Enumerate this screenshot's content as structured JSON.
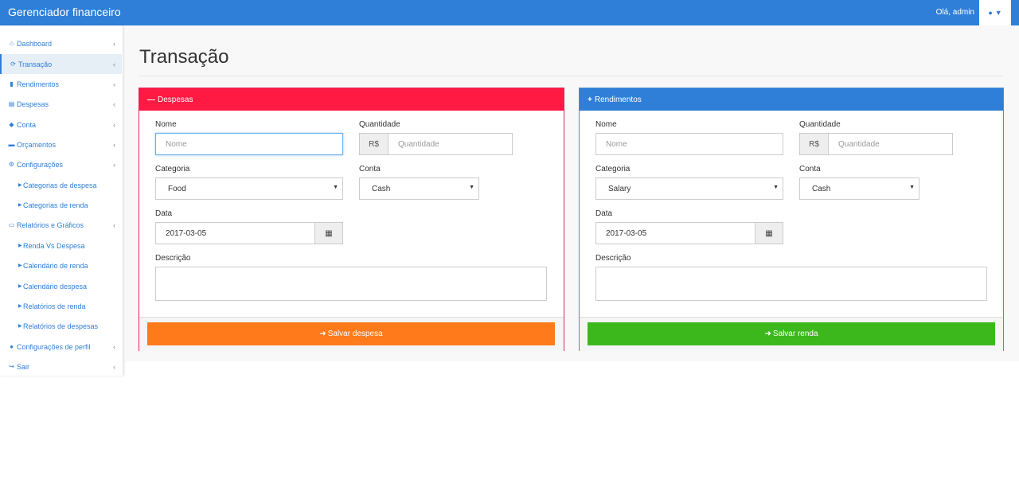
{
  "app": {
    "title": "Gerenciador financeiro",
    "greeting": "Olá, admin",
    "user_icon": "user-icon"
  },
  "sidebar": {
    "items": [
      {
        "label": "Dashboard",
        "icon": "home-icon",
        "glyph": "⌂"
      },
      {
        "label": "Transação",
        "icon": "refresh-icon",
        "glyph": "⟳",
        "active": true
      },
      {
        "label": "Rendimentos",
        "icon": "bar-chart-icon",
        "glyph": "▮"
      },
      {
        "label": "Despesas",
        "icon": "list-icon",
        "glyph": "▤"
      },
      {
        "label": "Conta",
        "icon": "tag-icon",
        "glyph": "◆"
      },
      {
        "label": "Orçamentos",
        "icon": "archive-icon",
        "glyph": "▬"
      },
      {
        "label": "Configurações",
        "icon": "gears-icon",
        "glyph": "⚙"
      },
      {
        "label": "Relatórios e Gráficos",
        "icon": "print-icon",
        "glyph": "▭"
      },
      {
        "label": "Configurações de perfil",
        "icon": "user-icon",
        "glyph": "●"
      },
      {
        "label": "Sair",
        "icon": "sign-out-icon",
        "glyph": "↪"
      }
    ],
    "config_subitems": [
      "Categorias de despesa",
      "Categorias de renda"
    ],
    "report_subitems": [
      "Renda Vs Despesa",
      "Calendário de renda",
      "Calendário despesa",
      "Relatórios de renda",
      "Relatórios de despesas"
    ]
  },
  "page": {
    "title": "Transação"
  },
  "expense": {
    "header": "Despesas",
    "nome_label": "Nome",
    "nome_placeholder": "Nome",
    "quantidade_label": "Quantidade",
    "currency": "R$",
    "quantidade_placeholder": "Quantidade",
    "categoria_label": "Categoria",
    "categoria_value": "Food",
    "conta_label": "Conta",
    "conta_value": "Cash",
    "data_label": "Data",
    "data_value": "2017-03-05",
    "descricao_label": "Descrição",
    "save_label": "Salvar despesa"
  },
  "income": {
    "header": "Rendimentos",
    "nome_label": "Nome",
    "nome_placeholder": "Nome",
    "quantidade_label": "Quantidade",
    "currency": "R$",
    "quantidade_placeholder": "Quantidade",
    "categoria_label": "Categoria",
    "categoria_value": "Salary",
    "conta_label": "Conta",
    "conta_value": "Cash",
    "data_label": "Data",
    "data_value": "2017-03-05",
    "descricao_label": "Descrição",
    "save_label": "Salvar renda"
  },
  "colors": {
    "navbar": "#2f7fd8",
    "expense_accent": "#ff1a44",
    "income_accent": "#2f7fd8",
    "expense_button": "#ff7a1a",
    "income_button": "#3cb81c"
  }
}
